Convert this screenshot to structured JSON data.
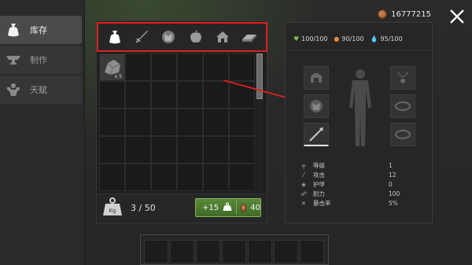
{
  "sidebar": {
    "items": [
      {
        "label": "库存",
        "icon": "bag-icon",
        "active": true
      },
      {
        "label": "制作",
        "icon": "anvil-icon",
        "active": false
      },
      {
        "label": "天赋",
        "icon": "strength-icon",
        "active": false
      }
    ]
  },
  "header": {
    "coins": "16777215"
  },
  "categories": [
    "bag-icon",
    "sword-icon",
    "armor-icon",
    "apple-icon",
    "house-icon",
    "ingot-icon"
  ],
  "inventory": {
    "item_qty": "x 5",
    "capacity": "3 / 50",
    "expand_plus": "+15",
    "expand_cost": "40"
  },
  "character": {
    "health": "100/100",
    "hunger": "90/100",
    "thirst": "95/100",
    "stats": [
      {
        "icon": "level-icon",
        "label": "等级",
        "value": "1"
      },
      {
        "icon": "attack-icon",
        "label": "攻击",
        "value": "12"
      },
      {
        "icon": "shield-icon",
        "label": "护甲",
        "value": "0"
      },
      {
        "icon": "run-icon",
        "label": "耐力",
        "value": "100"
      },
      {
        "icon": "crit-icon",
        "label": "暴击率",
        "value": "5%"
      }
    ]
  },
  "colors": {
    "highlight": "#e02020",
    "health": "#7dc04a",
    "hunger": "#e58a3a",
    "thirst": "#3aa0e0",
    "expand_button": "#4f7c33"
  }
}
